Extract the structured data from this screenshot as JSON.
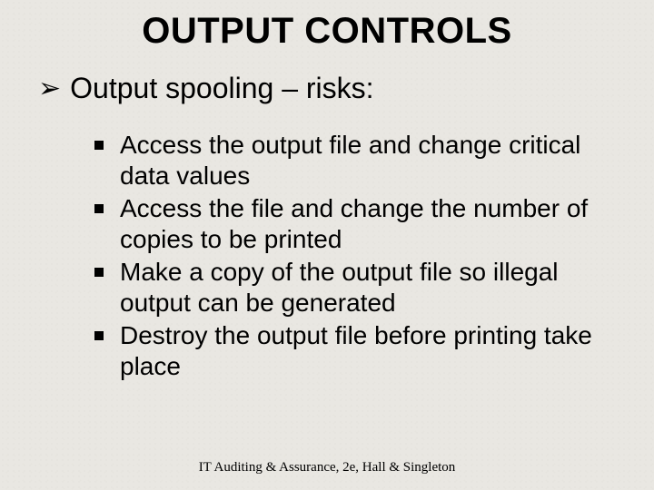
{
  "title": "OUTPUT CONTROLS",
  "main_bullet": {
    "marker": "➢",
    "text": "Output spooling – risks:"
  },
  "sub_bullets": [
    "Access the output file and change critical data values",
    "Access the file and change the number of copies to be printed",
    "Make a copy of the output file so illegal output can be generated",
    "Destroy the output file before printing take place"
  ],
  "footer": "IT Auditing & Assurance, 2e, Hall & Singleton"
}
